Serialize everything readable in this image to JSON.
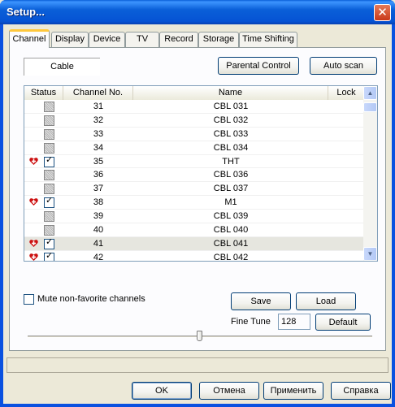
{
  "window": {
    "title": "Setup...",
    "close_glyph": "✕"
  },
  "tabs": [
    {
      "label": "Channel",
      "active": true
    },
    {
      "label": "Display"
    },
    {
      "label": "Device"
    },
    {
      "label": "TV"
    },
    {
      "label": "Record"
    },
    {
      "label": "Storage"
    },
    {
      "label": "Time Shifting"
    }
  ],
  "channel": {
    "source": "Cable",
    "parental_label": "Parental Control",
    "autoscan_label": "Auto scan",
    "columns": {
      "status": "Status",
      "number": "Channel No.",
      "name": "Name",
      "lock": "Lock"
    },
    "rows": [
      {
        "num": "31",
        "name": "CBL 031",
        "fav": false,
        "checked": false
      },
      {
        "num": "32",
        "name": "CBL 032",
        "fav": false,
        "checked": false
      },
      {
        "num": "33",
        "name": "CBL 033",
        "fav": false,
        "checked": false
      },
      {
        "num": "34",
        "name": "CBL 034",
        "fav": false,
        "checked": false
      },
      {
        "num": "35",
        "name": "THT",
        "fav": true,
        "checked": true
      },
      {
        "num": "36",
        "name": "CBL 036",
        "fav": false,
        "checked": false
      },
      {
        "num": "37",
        "name": "CBL 037",
        "fav": false,
        "checked": false
      },
      {
        "num": "38",
        "name": "M1",
        "fav": true,
        "checked": true
      },
      {
        "num": "39",
        "name": "CBL 039",
        "fav": false,
        "checked": false
      },
      {
        "num": "40",
        "name": "CBL 040",
        "fav": false,
        "checked": false
      },
      {
        "num": "41",
        "name": "CBL 041",
        "fav": true,
        "checked": true,
        "selected": true
      },
      {
        "num": "42",
        "name": "CBL 042",
        "fav": true,
        "checked": true
      }
    ],
    "mute_label": "Mute non-favorite channels",
    "save_label": "Save",
    "load_label": "Load",
    "finetune_label": "Fine Tune",
    "finetune_value": "128",
    "default_label": "Default",
    "slider_fraction": 0.5
  },
  "footer": {
    "ok_label": "OK",
    "cancel_label": "Отмена",
    "apply_label": "Применить",
    "help_label": "Справка"
  },
  "colors": {
    "favorite": "#cc1111",
    "title_bar": "#0a5fd8"
  }
}
